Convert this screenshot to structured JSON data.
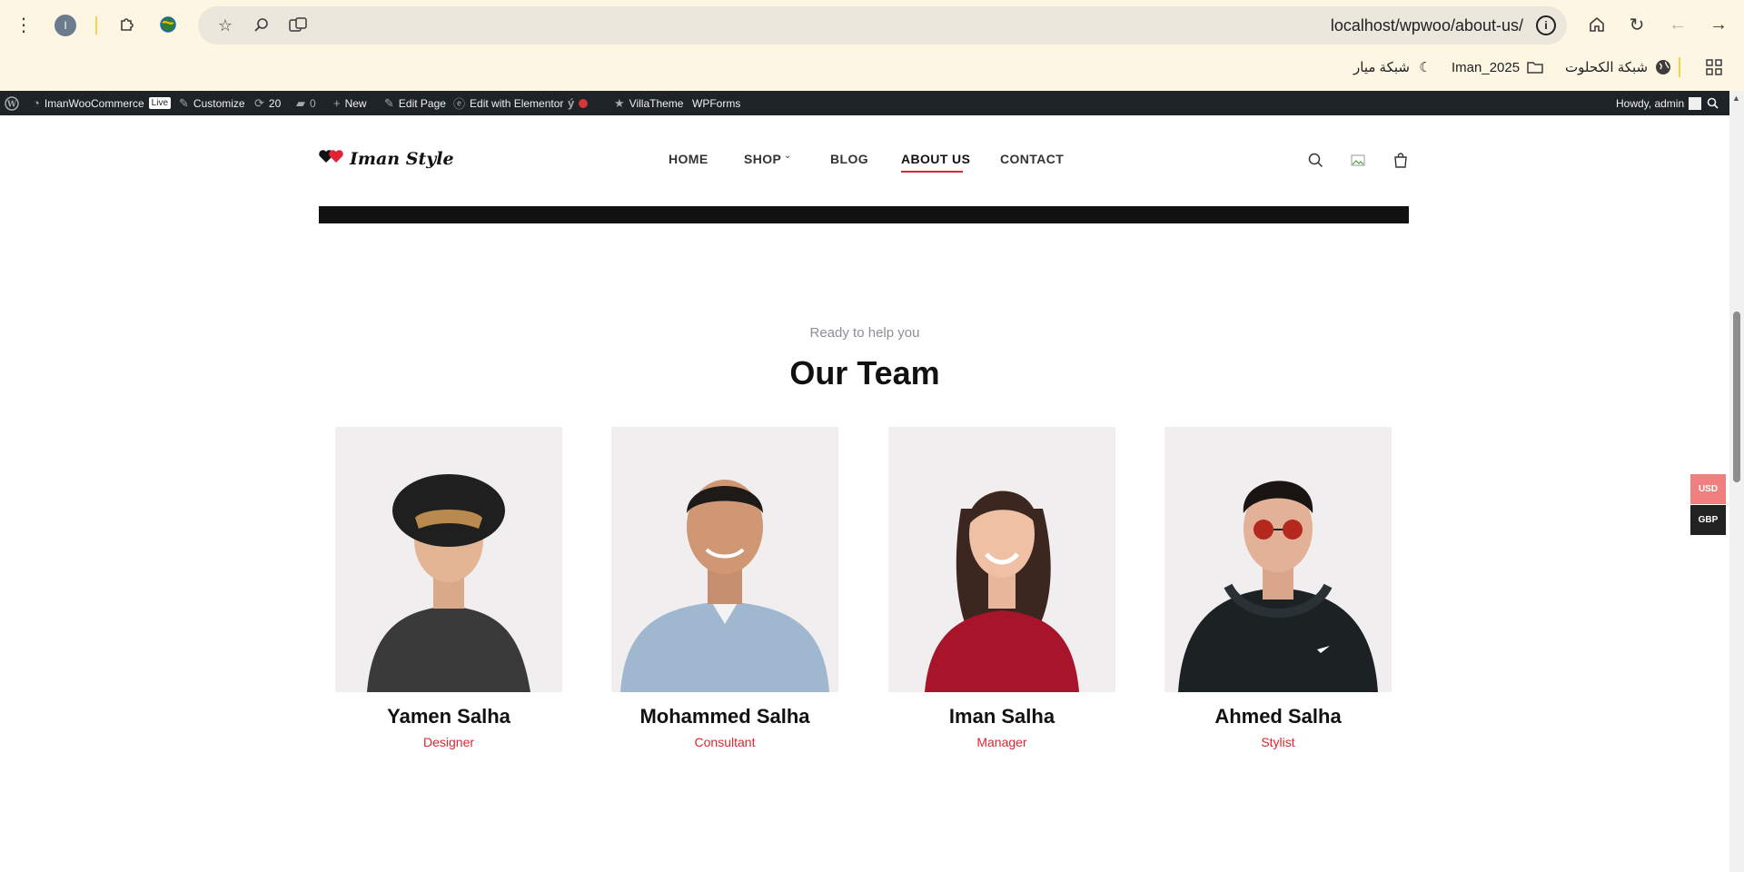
{
  "browser": {
    "url": "localhost/wpwoo/about-us/",
    "profile_initial": "I",
    "bookmarks": [
      {
        "label": "شبكة الكحلوت",
        "icon": "globe-icon"
      },
      {
        "label": "Iman_2025",
        "icon": "folder-icon"
      },
      {
        "label": "شبكة ميار",
        "icon": "moon-icon"
      }
    ]
  },
  "adminbar": {
    "site": "ImanWooCommerce",
    "live": "Live",
    "customize": "Customize",
    "updates": "20",
    "comments": "0",
    "new": "New",
    "edit_page": "Edit Page",
    "elementor": "Edit with Elementor",
    "villatheme": "VillaTheme",
    "wpforms": "WPForms",
    "howdy": "Howdy, admin"
  },
  "site": {
    "logo": "Iman Style",
    "nav": {
      "home": "HOME",
      "shop": "SHOP",
      "blog": "BLOG",
      "about": "ABOUT US",
      "contact": "CONTACT"
    },
    "accent": "#e02433"
  },
  "team": {
    "eyebrow": "Ready to help you",
    "heading": "Our Team",
    "members": [
      {
        "name": "Yamen Salha",
        "role": "Designer"
      },
      {
        "name": "Mohammed Salha",
        "role": "Consultant"
      },
      {
        "name": "Iman Salha",
        "role": "Manager"
      },
      {
        "name": "Ahmed Salha",
        "role": "Stylist"
      }
    ]
  },
  "currency": {
    "usd": "USD",
    "gbp": "GBP"
  }
}
